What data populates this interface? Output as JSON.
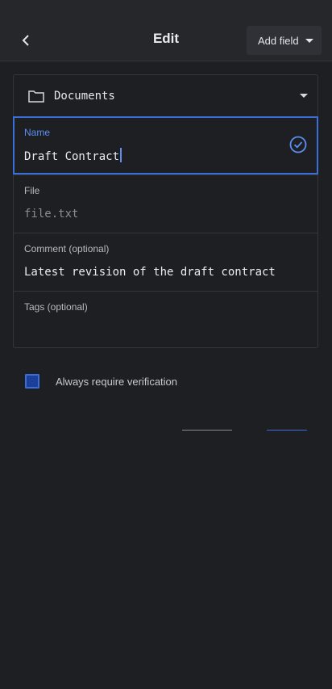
{
  "header": {
    "title": "Edit",
    "add_field_label": "Add field"
  },
  "form": {
    "folder": {
      "label": "Documents",
      "icon": "folder-icon"
    },
    "name": {
      "label": "Name",
      "value": "Draft Contract"
    },
    "file": {
      "label": "File",
      "value": "file.txt"
    },
    "comment": {
      "label": "Comment (optional)",
      "value": "Latest revision of the draft contract"
    },
    "tags": {
      "label": "Tags (optional)",
      "value": ""
    }
  },
  "verification": {
    "label": "Always require verification",
    "checked": true
  },
  "colors": {
    "accent": "#3a6fd8",
    "background": "#1e1f23",
    "header": "#26272b"
  }
}
